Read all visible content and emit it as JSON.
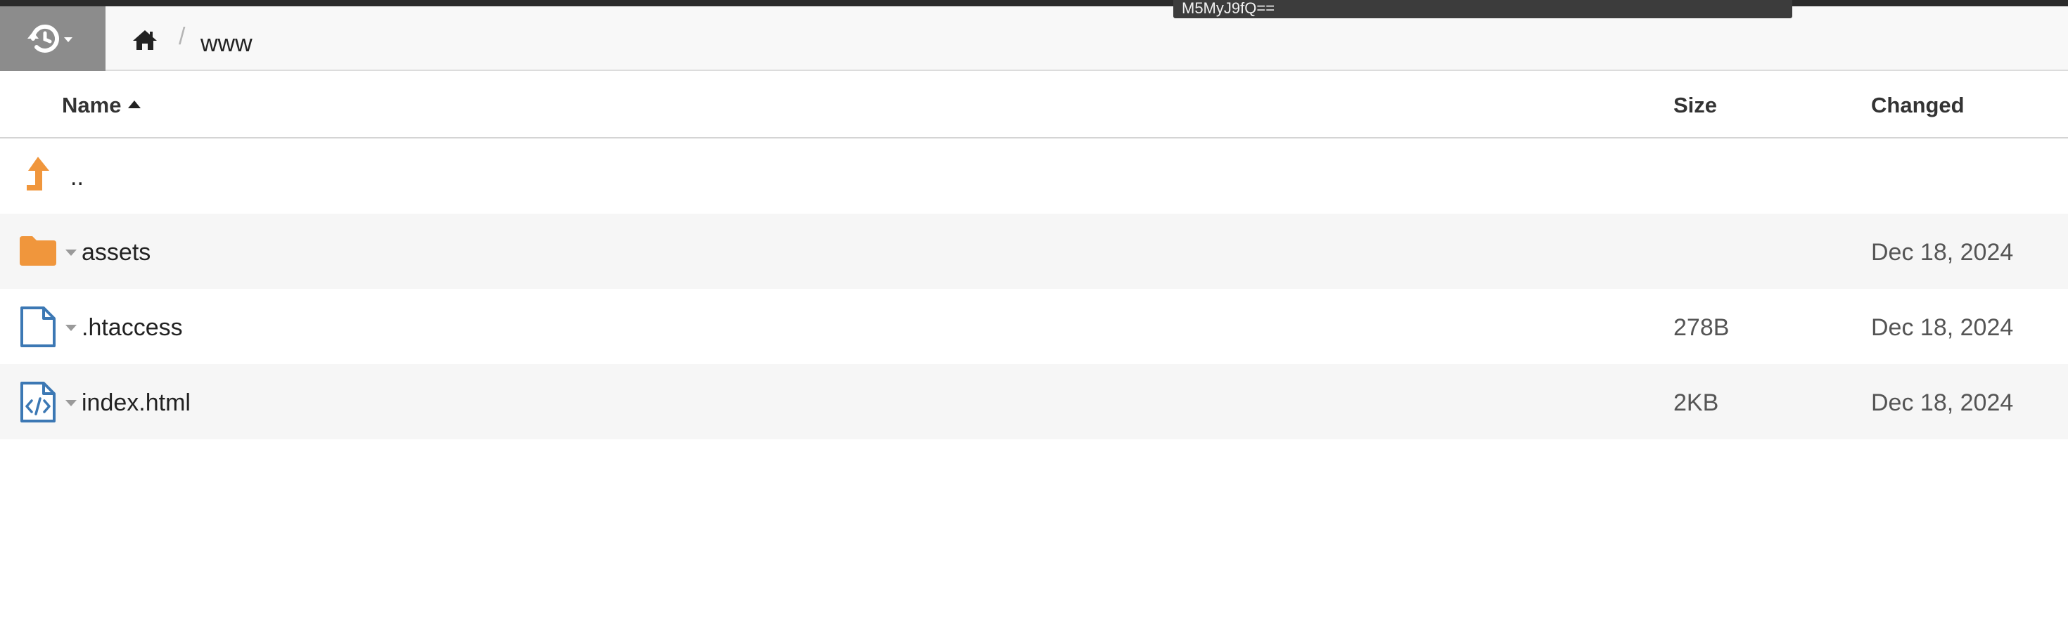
{
  "tooltip": {
    "text": "M5MyJ9fQ=="
  },
  "breadcrumb": {
    "history_icon": "history-icon",
    "home_icon": "home-icon",
    "separator": "/",
    "current": "www"
  },
  "columns": {
    "name": "Name",
    "name_sort": "ascending",
    "size": "Size",
    "changed": "Changed"
  },
  "rows": [
    {
      "name": "..",
      "size": "",
      "changed": "",
      "icon": "up-arrow-icon",
      "icon_color": "#f0963c"
    },
    {
      "name": "assets",
      "size": "",
      "changed": "Dec 18, 2024",
      "icon": "folder-icon",
      "icon_color": "#f0963c"
    },
    {
      "name": ".htaccess",
      "size": "278B",
      "changed": "Dec 18, 2024",
      "icon": "file-icon",
      "icon_color": "#3c78b4"
    },
    {
      "name": "index.html",
      "size": "2KB",
      "changed": "Dec 18, 2024",
      "icon": "code-file-icon",
      "icon_color": "#3c78b4"
    }
  ],
  "colors": {
    "accent_orange": "#f0963c",
    "accent_blue": "#3c78b4",
    "toolbar_button": "#8c8c8c"
  }
}
